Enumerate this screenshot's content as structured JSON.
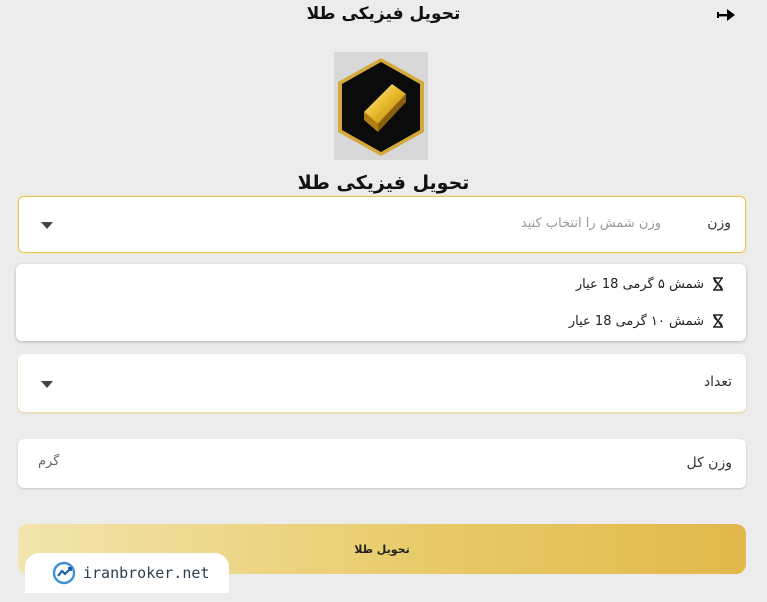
{
  "header": {
    "title": "تحویل فیزیکی طلا",
    "back_icon": "arrow-right-icon"
  },
  "logo": {
    "icon": "gold-bar-icon"
  },
  "page": {
    "heading": "تحویل فیزیکی طلا"
  },
  "weight_field": {
    "label": "وزن",
    "placeholder": "وزن شمش را انتخاب کنید"
  },
  "weight_options": [
    {
      "label": "شمش ۵ گرمی 18 عیار",
      "icon": "hourglass-icon"
    },
    {
      "label": "شمش ۱۰ گرمی 18 عیار",
      "icon": "hourglass-icon"
    }
  ],
  "count_field": {
    "label": "تعداد"
  },
  "total_field": {
    "label": "وزن کل",
    "unit": "گرم"
  },
  "submit": {
    "label": "تحویل طلا"
  },
  "watermark": {
    "text": "iranbroker.net"
  },
  "colors": {
    "accent_gold": "#e2b84a",
    "border_gold": "#e7c45f",
    "background": "#ececec"
  }
}
